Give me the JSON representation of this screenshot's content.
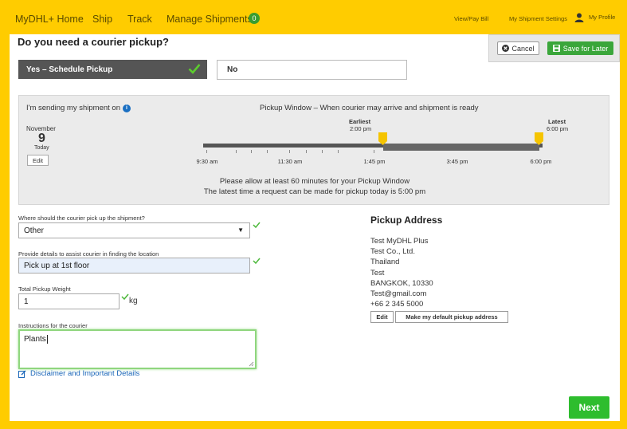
{
  "nav": {
    "brand": "MyDHL+ Home",
    "ship": "Ship",
    "track": "Track",
    "manage": "Manage Shipments",
    "manage_count": "0",
    "view_pay_bill": "View/Pay Bill",
    "shipment_settings": "My Shipment Settings",
    "profile": "My Profile"
  },
  "page": {
    "title": "Do you need a courier pickup?",
    "cancel_label": "Cancel",
    "save_later_label": "Save for Later"
  },
  "options": {
    "yes_label": "Yes – Schedule Pickup",
    "no_label": "No"
  },
  "schedule": {
    "sending_label": "I'm sending my shipment on",
    "month": "November",
    "day": "9",
    "day_note": "Today",
    "edit_label": "Edit",
    "window_title": "Pickup Window – When courier may arrive and shipment is ready",
    "earliest_label": "Earliest",
    "earliest_time": "2:00 pm",
    "latest_label": "Latest",
    "latest_time": "6:00 pm",
    "ticks": [
      "9:30 am",
      "11:30 am",
      "1:45 pm",
      "3:45 pm",
      "6:00 pm"
    ],
    "note1": "Please allow at least 60 minutes for your Pickup Window",
    "note2": "The latest time a request can be made for pickup today is 5:00 pm"
  },
  "form": {
    "location_label": "Where should the courier pick up the shipment?",
    "location_value": "Other",
    "details_label": "Provide details to assist courier in finding the location",
    "details_value": "Pick up at 1st floor",
    "weight_label": "Total Pickup Weight",
    "weight_value": "1",
    "weight_unit": "kg",
    "instructions_label": "Instructions for the courier",
    "instructions_value": "Plants",
    "disclaimer": "Disclaimer and Important Details"
  },
  "address": {
    "title": "Pickup Address",
    "lines": [
      "Test MyDHL Plus",
      "Test Co., Ltd.",
      "Thailand",
      "Test",
      "BANGKOK, 10330",
      "Test@gmail.com",
      "+66 2 345 5000"
    ],
    "edit_label": "Edit",
    "default_label": "Make my default pickup address"
  },
  "footer": {
    "next_label": "Next"
  },
  "colors": {
    "brand_yellow": "#ffcc00",
    "accent_green": "#2ebd2e",
    "marker_yellow": "#f5c400"
  }
}
